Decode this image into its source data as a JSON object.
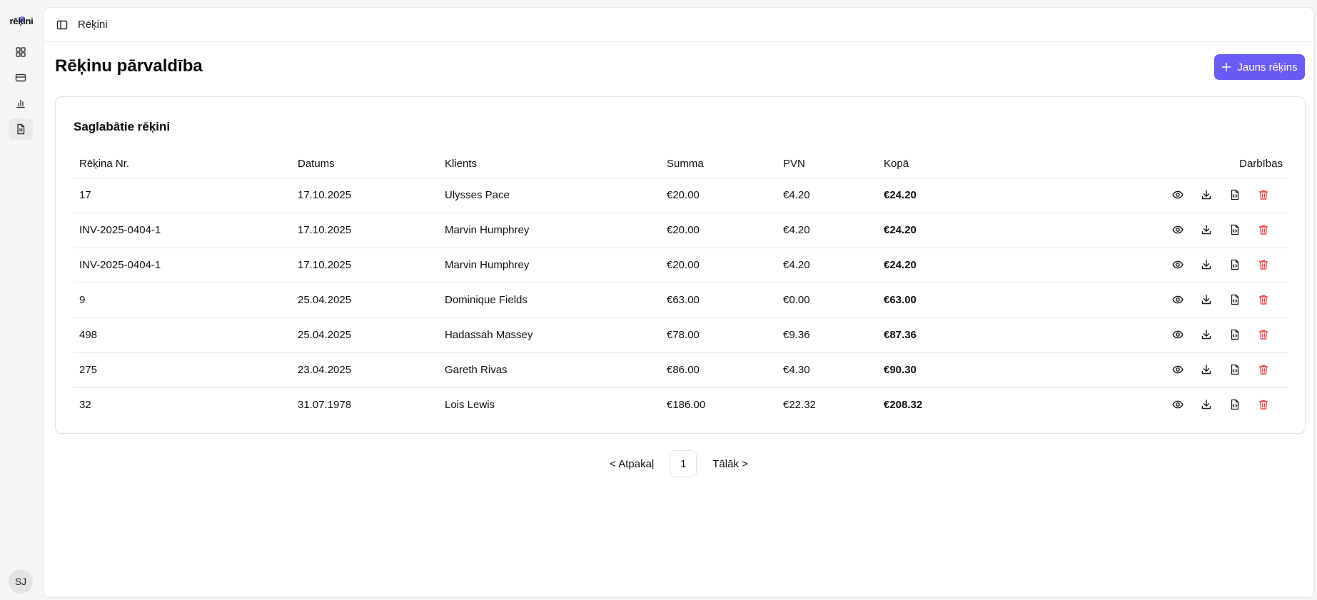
{
  "app": {
    "logo_text": "rēķini",
    "colors": {
      "accent": "#6a5cf2",
      "danger": "#ef4444"
    }
  },
  "sidebar": {
    "items": [
      {
        "name": "dashboard",
        "icon": "grid-icon"
      },
      {
        "name": "payments",
        "icon": "credit-card-icon"
      },
      {
        "name": "reports",
        "icon": "bar-chart-icon"
      },
      {
        "name": "invoices",
        "icon": "document-icon",
        "active": true
      }
    ],
    "avatar_initials": "SJ"
  },
  "header": {
    "breadcrumb": "Rēķini"
  },
  "page": {
    "title": "Rēķinu pārvaldība",
    "new_button_label": "Jauns rēķins"
  },
  "card": {
    "title": "Saglabātie rēķini",
    "columns": [
      "Rēķina Nr.",
      "Datums",
      "Klients",
      "Summa",
      "PVN",
      "Kopā",
      "Darbības"
    ],
    "rows": [
      {
        "number": "17",
        "date": "17.10.2025",
        "client": "Ulysses Pace",
        "sum": "€20.00",
        "vat": "€4.20",
        "total": "€24.20"
      },
      {
        "number": "INV-2025-0404-1",
        "date": "17.10.2025",
        "client": "Marvin Humphrey",
        "sum": "€20.00",
        "vat": "€4.20",
        "total": "€24.20"
      },
      {
        "number": "INV-2025-0404-1",
        "date": "17.10.2025",
        "client": "Marvin Humphrey",
        "sum": "€20.00",
        "vat": "€4.20",
        "total": "€24.20"
      },
      {
        "number": "9",
        "date": "25.04.2025",
        "client": "Dominique Fields",
        "sum": "€63.00",
        "vat": "€0.00",
        "total": "€63.00"
      },
      {
        "number": "498",
        "date": "25.04.2025",
        "client": "Hadassah Massey",
        "sum": "€78.00",
        "vat": "€9.36",
        "total": "€87.36"
      },
      {
        "number": "275",
        "date": "23.04.2025",
        "client": "Gareth Rivas",
        "sum": "€86.00",
        "vat": "€4.30",
        "total": "€90.30"
      },
      {
        "number": "32",
        "date": "31.07.1978",
        "client": "Lois Lewis",
        "sum": "€186.00",
        "vat": "€22.32",
        "total": "€208.32"
      }
    ]
  },
  "pagination": {
    "prev_label": "< Atpakaļ",
    "current_page": "1",
    "next_label": "Tālāk >"
  }
}
